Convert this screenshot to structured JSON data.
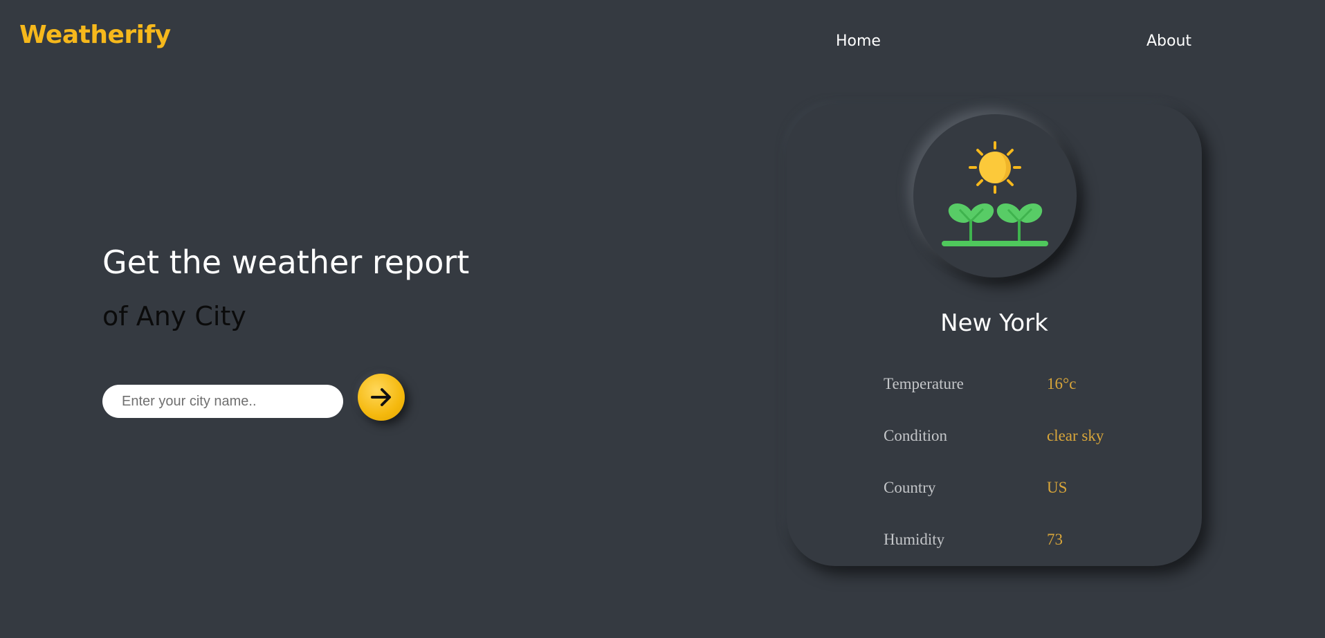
{
  "brand": "Weatherify",
  "nav": {
    "home": "Home",
    "about": "About"
  },
  "hero": {
    "title": "Get the weather report",
    "subtitle": "of Any City"
  },
  "search": {
    "placeholder": "Enter your city name..",
    "value": ""
  },
  "icons": {
    "submit": "arrow-right-icon",
    "weather": "sun-over-sprouts-icon"
  },
  "card": {
    "city": "New York",
    "rows": [
      {
        "label": "Temperature",
        "value": "16°c"
      },
      {
        "label": "Condition",
        "value": "clear sky"
      },
      {
        "label": "Country",
        "value": "US"
      },
      {
        "label": "Humidity",
        "value": "73"
      }
    ]
  },
  "colors": {
    "background": "#353a41",
    "accent": "#f6b81c",
    "value_text": "#d9a63a"
  }
}
